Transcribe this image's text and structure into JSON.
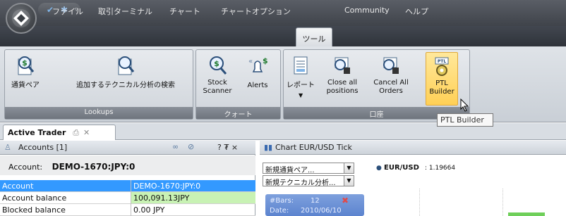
{
  "menu": {
    "items": [
      "ファイル",
      "取引ターミナル",
      "チャート",
      "チャートオプション",
      "ツール",
      "Community",
      "ヘルプ"
    ],
    "active": "ツール"
  },
  "ribbon": {
    "lookups": {
      "label": "Lookups",
      "currency_pair": "通貨ペア",
      "search_ta": "追加するテクニカル分析の検索"
    },
    "quotes": {
      "label": "クォート",
      "stock_scanner": "Stock Scanner",
      "alerts": "Alerts"
    },
    "account": {
      "label": "口座",
      "report": "レポート",
      "close_all": "Close all positions",
      "cancel_all": "Cancel All Orders",
      "ptl_builder": "PTL Builder"
    },
    "tooltip": "PTL Builder"
  },
  "workspace": {
    "tab_title": "Active Trader"
  },
  "accounts_panel": {
    "title": "Accounts [1]",
    "account_label": "Account:",
    "account_value": "DEMO-1670:JPY:0",
    "header_controls": "? ₮ ×",
    "rows": [
      {
        "name": "Account",
        "value": "DEMO-1670:JPY:0"
      },
      {
        "name": "Account balance",
        "value": "100,091.13JPY"
      },
      {
        "name": "Blocked balance",
        "value": "0.00 JPY"
      }
    ]
  },
  "chart_panel": {
    "title": "Chart EUR/USD Tick",
    "combo_pair": "新規通貨ペア...",
    "combo_ta": "新規テクニカル分析...",
    "symbol": "EUR/USD",
    "price": ": 1.19664",
    "info": {
      "bars_label": "#Bars:",
      "bars_value": "12",
      "date_label": "Date:",
      "date_value": "2010/06/10"
    }
  },
  "colors": {
    "selected_row": "#3399ff",
    "balance_row": "#c8f2b4",
    "ribbon_highlight": "#ffd056"
  }
}
